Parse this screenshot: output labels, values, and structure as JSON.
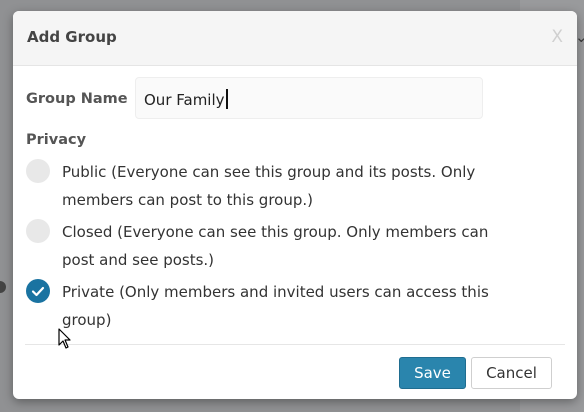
{
  "dialog": {
    "title": "Add Group",
    "close_label": "X"
  },
  "form": {
    "name_label": "Group Name",
    "name_value": "Our Family",
    "privacy_label": "Privacy",
    "options": [
      {
        "line1": "Public (Everyone can see this group and its posts. Only",
        "line2": "members can post to this group.)",
        "selected": false
      },
      {
        "line1": "Closed (Everyone can see this group. Only members can",
        "line2": "post and see posts.)",
        "selected": false
      },
      {
        "line1": "Private (Only members and invited users can access this",
        "line2": "group)",
        "selected": true
      }
    ]
  },
  "actions": {
    "save_label": "Save",
    "cancel_label": "Cancel"
  },
  "colors": {
    "accent": "#2a85ad",
    "radio_checked": "#1a73a1",
    "radio_unchecked": "#e8e8e8"
  },
  "icons": [
    "close-icon",
    "check-icon",
    "mouse-pointer-icon"
  ]
}
